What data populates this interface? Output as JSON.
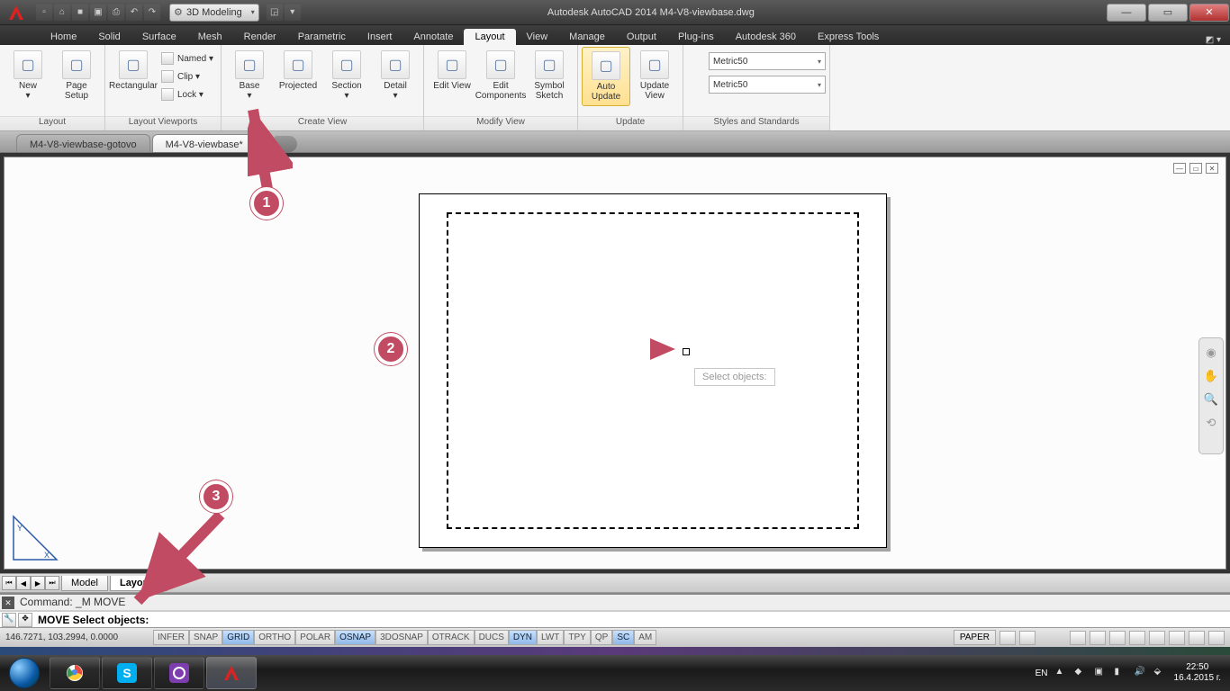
{
  "app": {
    "title_full": "Autodesk AutoCAD 2014    M4-V8-viewbase.dwg"
  },
  "workspace": "3D Modeling",
  "qat": [
    "new",
    "open",
    "save",
    "saveall",
    "plot",
    "undo",
    "redo"
  ],
  "menu_tabs": [
    "Home",
    "Solid",
    "Surface",
    "Mesh",
    "Render",
    "Parametric",
    "Insert",
    "Annotate",
    "Layout",
    "View",
    "Manage",
    "Output",
    "Plug-ins",
    "Autodesk 360",
    "Express Tools"
  ],
  "menu_active": "Layout",
  "ribbon": {
    "panels": [
      {
        "label": "Layout",
        "big": [
          {
            "txt": "New",
            "k": "new-layout"
          },
          {
            "txt": "Page Setup",
            "k": "page-setup"
          }
        ]
      },
      {
        "label": "Layout Viewports",
        "big": [
          {
            "txt": "Rectangular",
            "k": "vp-rect"
          }
        ],
        "stack": [
          {
            "txt": "Named",
            "k": "vp-named"
          },
          {
            "txt": "Clip",
            "k": "vp-clip"
          },
          {
            "txt": "Lock",
            "k": "vp-lock"
          }
        ]
      },
      {
        "label": "Create View",
        "big": [
          {
            "txt": "Base",
            "k": "view-base"
          },
          {
            "txt": "Projected",
            "k": "view-projected"
          },
          {
            "txt": "Section",
            "k": "view-section"
          },
          {
            "txt": "Detail",
            "k": "view-detail"
          }
        ]
      },
      {
        "label": "Modify View",
        "big": [
          {
            "txt": "Edit View",
            "k": "edit-view"
          },
          {
            "txt": "Edit Components",
            "k": "edit-comp"
          },
          {
            "txt": "Symbol Sketch",
            "k": "symbol-sketch"
          }
        ]
      },
      {
        "label": "Update",
        "big": [
          {
            "txt": "Auto Update",
            "k": "auto-update",
            "active": true
          },
          {
            "txt": "Update View",
            "k": "update-view"
          }
        ]
      },
      {
        "label": "Styles and Standards",
        "combos": [
          "Metric50",
          "Metric50"
        ]
      }
    ]
  },
  "doc_tabs": [
    {
      "txt": "M4-V8-viewbase-gotovo",
      "active": false
    },
    {
      "txt": "M4-V8-viewbase*",
      "active": true
    }
  ],
  "layout_tabs": {
    "items": [
      "Model",
      "Layout2"
    ],
    "active": "Layout2"
  },
  "tooltip": "Select objects:",
  "cmd": {
    "history": "Command: _M MOVE",
    "prompt": "MOVE Select objects:"
  },
  "status": {
    "coords": "146.7271, 103.2994, 0.0000",
    "toggles": [
      {
        "t": "INFER",
        "on": false
      },
      {
        "t": "SNAP",
        "on": false
      },
      {
        "t": "GRID",
        "on": true
      },
      {
        "t": "ORTHO",
        "on": false
      },
      {
        "t": "POLAR",
        "on": false
      },
      {
        "t": "OSNAP",
        "on": true
      },
      {
        "t": "3DOSNAP",
        "on": false
      },
      {
        "t": "OTRACK",
        "on": false
      },
      {
        "t": "DUCS",
        "on": false
      },
      {
        "t": "DYN",
        "on": true
      },
      {
        "t": "LWT",
        "on": false
      },
      {
        "t": "TPY",
        "on": false
      },
      {
        "t": "QP",
        "on": false
      },
      {
        "t": "SC",
        "on": true
      },
      {
        "t": "AM",
        "on": false
      }
    ],
    "space": "PAPER"
  },
  "tray": {
    "lang": "EN",
    "time": "22:50",
    "date": "16.4.2015 г."
  },
  "callouts": {
    "c1": "1",
    "c2": "2",
    "c3": "3"
  }
}
